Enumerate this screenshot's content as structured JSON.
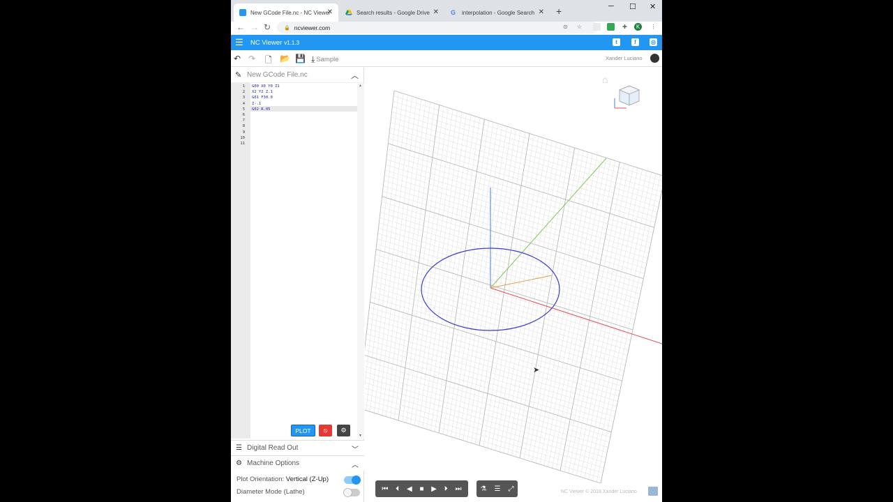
{
  "browser": {
    "tabs": [
      {
        "title": "New GCode File.nc - NC Viewer",
        "active": true
      },
      {
        "title": "Search results - Google Drive",
        "active": false
      },
      {
        "title": "interpolation - Google Search",
        "active": false
      }
    ],
    "new_tab_icon": "plus-icon",
    "url": "ncviewer.com",
    "profile_initial": "K"
  },
  "app": {
    "name": "NC Viewer",
    "version": "v1.1.3",
    "sample_label": "Sample",
    "user_name": "Xander Luciano",
    "accent_color": "#2196f3"
  },
  "editor": {
    "file_name": "New GCode File.nc",
    "lines": [
      {
        "num": "1",
        "code": "G00 X0 Y0 Z1"
      },
      {
        "num": "2",
        "code": "X2 Y2 Z.1"
      },
      {
        "num": "3",
        "code": "G01 F30.0"
      },
      {
        "num": "4",
        "code": "Z-.1"
      },
      {
        "num": "5",
        "code": "G02 R.05"
      },
      {
        "num": "6",
        "code": ""
      },
      {
        "num": "7",
        "code": ""
      },
      {
        "num": "8",
        "code": ""
      },
      {
        "num": "9",
        "code": ""
      },
      {
        "num": "10",
        "code": ""
      },
      {
        "num": "11",
        "code": ""
      }
    ],
    "plot_label": "PLOT"
  },
  "panels": {
    "dro_label": "Digital Read Out",
    "machine_options_label": "Machine Options",
    "plot_orientation_label": "Plot Orientation:",
    "plot_orientation_value": "Vertical (Z-Up)",
    "plot_orientation_on": true,
    "diameter_mode_label": "Diameter Mode (Lathe)",
    "diameter_mode_on": false
  },
  "viewport": {
    "copyright": "NC Viewer © 2018 Xander Luciano"
  }
}
